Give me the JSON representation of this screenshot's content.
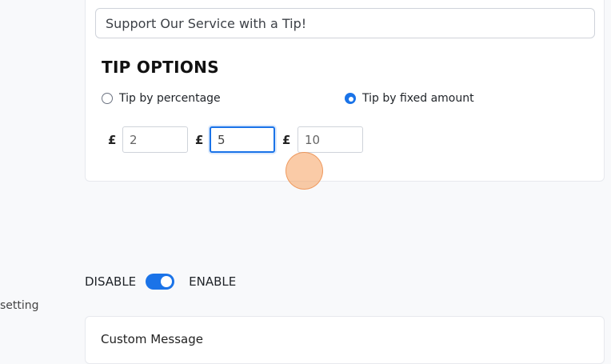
{
  "tip_card": {
    "title_value": "Support Our Service with a Tip!",
    "heading": "TIP OPTIONS",
    "options": [
      {
        "label": "Tip by percentage",
        "checked": false
      },
      {
        "label": "Tip by fixed amount",
        "checked": true
      }
    ],
    "currency_symbol": "£",
    "amounts": [
      "2",
      "5",
      "10"
    ]
  },
  "toggle": {
    "off_label": "DISABLE",
    "on_label": "ENABLE",
    "state": "on"
  },
  "sidebar": {
    "partial_label": "setting"
  },
  "custom_message": {
    "label": "Custom Message"
  },
  "colors": {
    "accent": "#1a73e8",
    "background": "#f8f9fb",
    "cursor_marker": "#f6a86c"
  }
}
